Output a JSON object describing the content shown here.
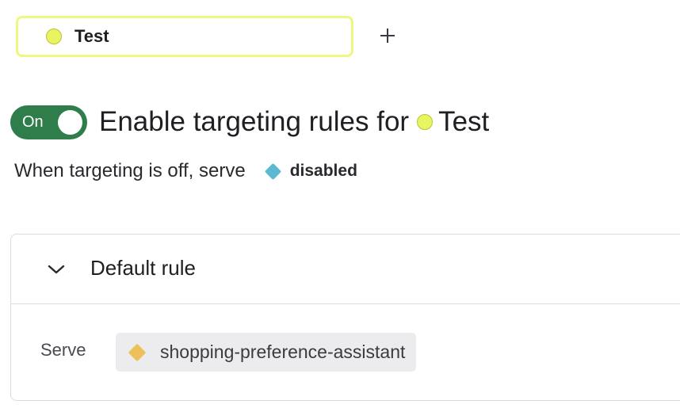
{
  "environment_tab": {
    "label": "Test",
    "dot_color": "#e8f560",
    "border_color": "#eef77e"
  },
  "add_environment_icon": "plus-icon",
  "targeting": {
    "toggle_label": "On",
    "toggle_state": "on",
    "toggle_color": "#2f7d4a",
    "heading_prefix": "Enable targeting rules for",
    "environment_name": "Test",
    "off_text": "When targeting is off, serve",
    "off_variation": "disabled",
    "off_variation_color": "#5db8d1"
  },
  "default_rule": {
    "collapse_icon": "chevron-down-icon",
    "title": "Default rule",
    "serve_label": "Serve",
    "serve_variation": "shopping-preference-assistant",
    "serve_variation_color": "#ecc15a"
  }
}
